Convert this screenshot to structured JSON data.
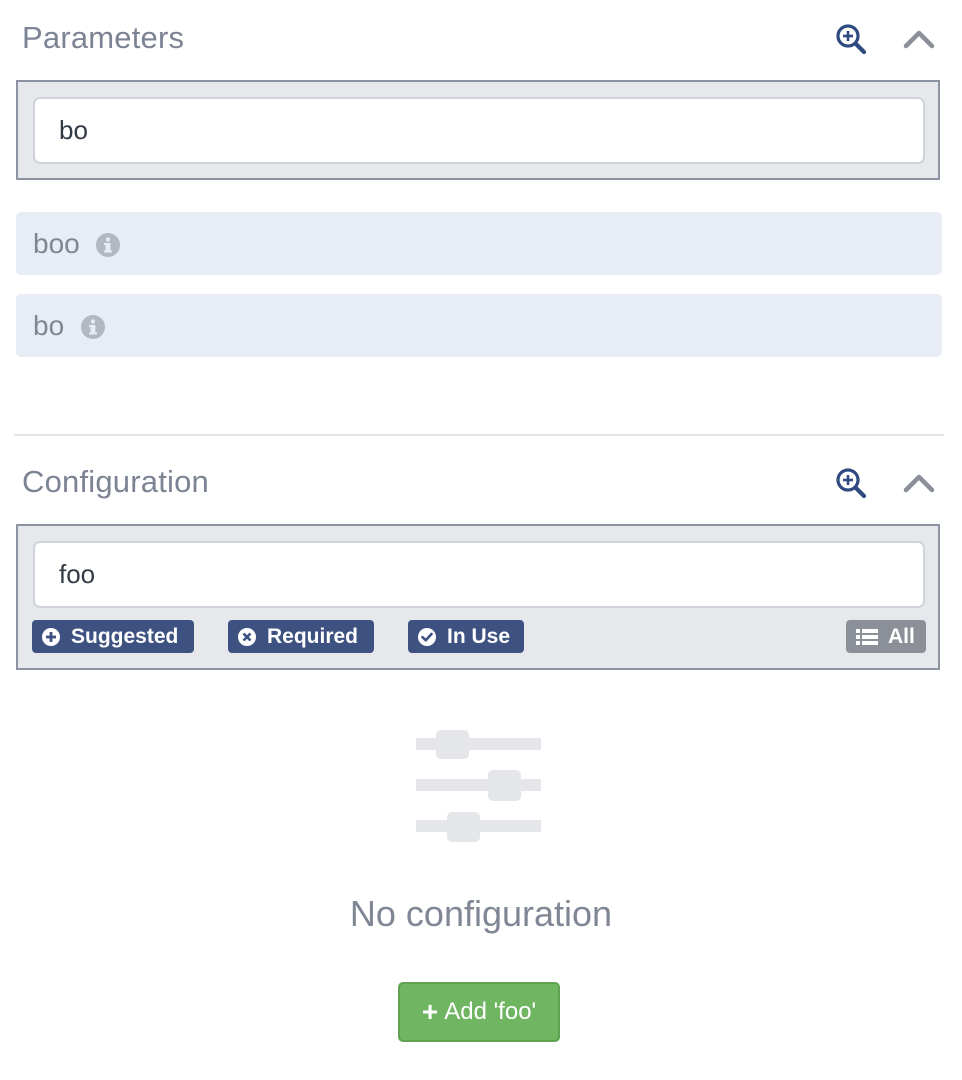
{
  "parameters": {
    "title": "Parameters",
    "search_value": "bo",
    "items": [
      {
        "label": "boo"
      },
      {
        "label": "bo"
      }
    ]
  },
  "configuration": {
    "title": "Configuration",
    "search_value": "foo",
    "filters": {
      "suggested": "Suggested",
      "required": "Required",
      "in_use": "In Use",
      "all": "All"
    },
    "empty_state": {
      "message": "No configuration",
      "add_button_label": "Add 'foo'"
    }
  },
  "icons": {
    "zoom": "zoom-in-icon",
    "collapse": "chevron-up-icon",
    "info": "info-circle-icon",
    "suggested": "plus-circle-icon",
    "required": "times-circle-icon",
    "in_use": "check-circle-icon",
    "all": "list-icon",
    "empty": "sliders-icon"
  },
  "colors": {
    "accent": "#3e5282",
    "success": "#6fb562",
    "muted": "#7f8694",
    "row_bg": "#e8ecf5"
  }
}
